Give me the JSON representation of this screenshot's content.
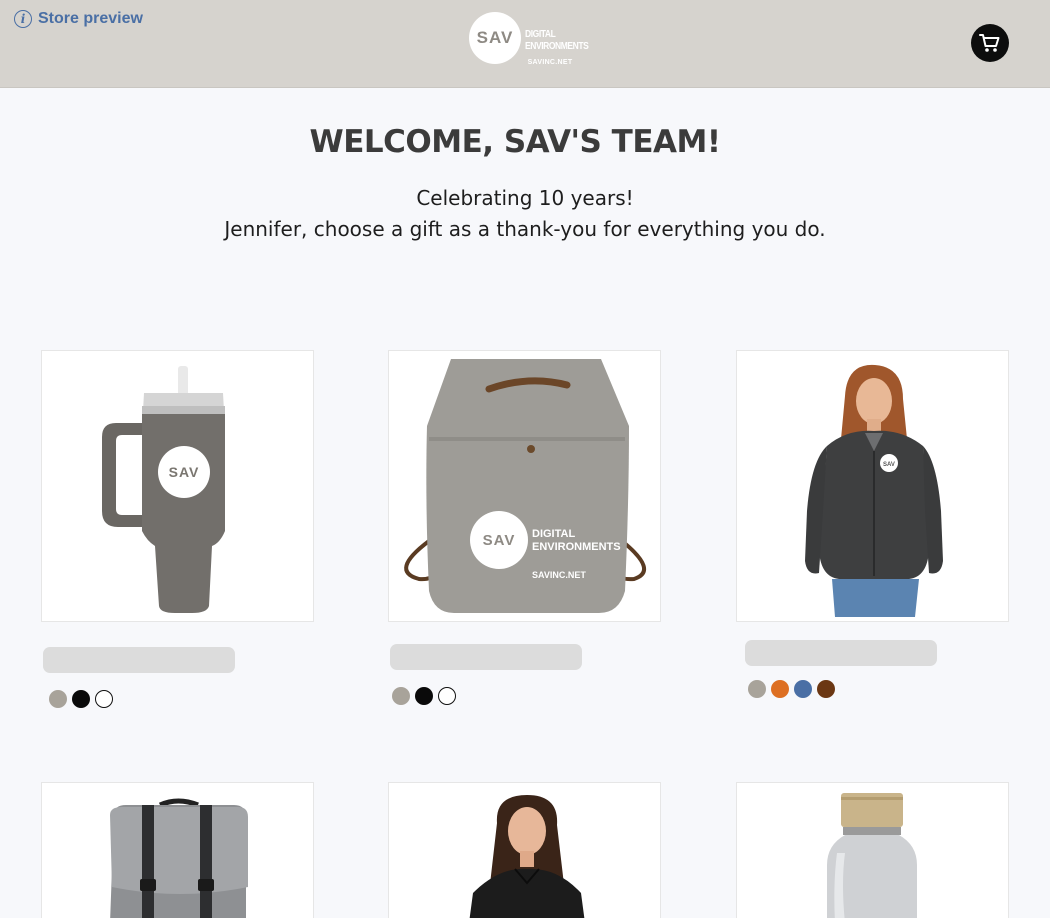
{
  "header": {
    "preview_label": "Store preview",
    "logo": {
      "mark": "SAV",
      "line1": "DIGITAL",
      "line2": "ENVIRONMENTS",
      "url": "SAVINC.NET"
    },
    "cart_icon": "cart-icon",
    "info_icon": "info-icon"
  },
  "hero": {
    "title": "WELCOME, SAV'S TEAM!",
    "subtitle_line1": "Celebrating 10 years!",
    "subtitle_line2": "Jennifer, choose a gift as a thank-you for everything you do."
  },
  "products": [
    {
      "image": "grey tumbler with handle and straw, SAV logo",
      "swatches": [
        "#a8a39a",
        "#0a0a0a",
        "#ffffff"
      ]
    },
    {
      "image": "grey canvas bucket backpack, SAV Digital Environments logo",
      "swatches": [
        "#a8a39a",
        "#0a0a0a",
        "#ffffff"
      ]
    },
    {
      "image": "woman in dark grey fleece jacket with SAV logo",
      "swatches": [
        "#a8a39a",
        "#dd6f22",
        "#4a6fa5",
        "#6b3713"
      ]
    },
    {
      "image": "heather grey flap backpack"
    },
    {
      "image": "woman in black button-up shirt"
    },
    {
      "image": "clear glass bottle with bamboo lid"
    }
  ],
  "colors": {
    "header_bg": "#d6d3ce",
    "page_bg": "#f7f8fb",
    "link": "#4a6fa5",
    "title": "#3b3b3b"
  }
}
